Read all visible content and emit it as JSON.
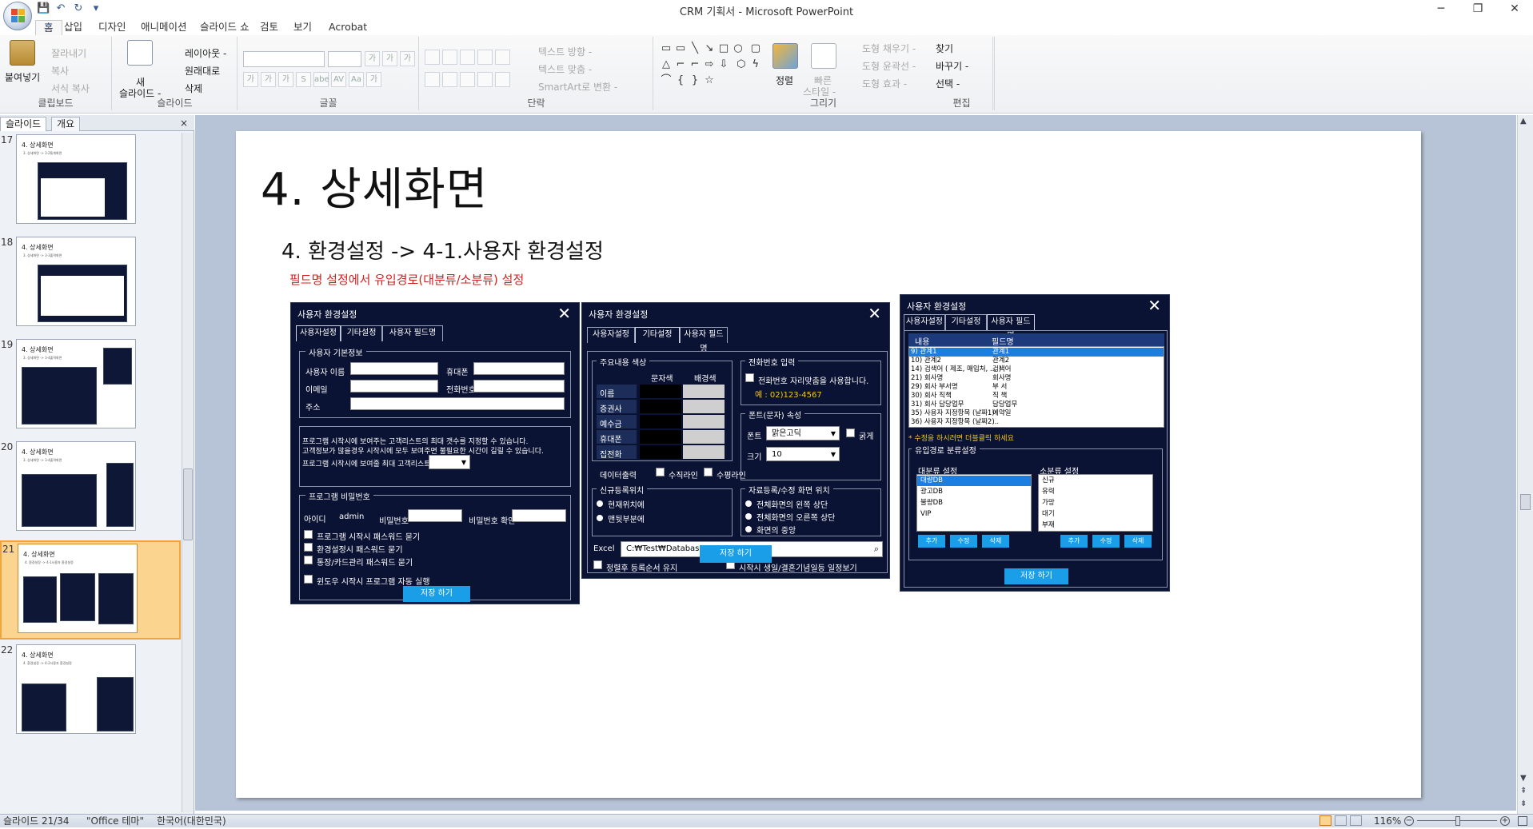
{
  "window": {
    "title": "CRM 기획서 - Microsoft PowerPoint",
    "min": "─",
    "max": "❐",
    "close": "✕"
  },
  "qat": {
    "save": "💾",
    "undo": "↶",
    "redo": "↻",
    "more": "▾"
  },
  "ribbon_tabs": [
    "홈",
    "삽입",
    "디자인",
    "애니메이션",
    "슬라이드 쇼",
    "검토",
    "보기",
    "Acrobat"
  ],
  "ribbon": {
    "clipboard": {
      "paste": "붙여넣기",
      "cut": "잘라내기",
      "copy": "복사",
      "format": "서식 복사",
      "label": "클립보드"
    },
    "slides": {
      "new": "새",
      "new2": "슬라이드 -",
      "layout": "레이아웃 -",
      "reset": "원래대로",
      "delete": "삭제",
      "label": "슬라이드"
    },
    "font": {
      "label": "글꼴",
      "grow": "가",
      "shrink": "가",
      "clear": "가",
      "bold": "가",
      "italic": "가",
      "underline": "가",
      "shadow": "S",
      "strike": "abe",
      "spacing": "AV",
      "case": "Aa",
      "color": "가"
    },
    "paragraph": {
      "direction": "텍스트 방향 -",
      "align": "텍스트 맞춤 -",
      "smartart": "SmartArt로 변환 -",
      "label": "단락"
    },
    "drawing": {
      "arrange": "정렬",
      "quick": "빠른",
      "quick2": "스타일 -",
      "fill": "도형 채우기 -",
      "outline": "도형 윤곽선 -",
      "effect": "도형 효과 -",
      "label": "그리기"
    },
    "editing": {
      "find": "찾기",
      "replace": "바꾸기 -",
      "select": "선택 -",
      "label": "편집"
    }
  },
  "left_panel": {
    "tab_slides": "슬라이드",
    "tab_outline": "개요",
    "close": "×",
    "thumbs": [
      {
        "num": "17",
        "title": "4. 상세화면",
        "sub": "3. 상세화면 -> 3-2통계화면"
      },
      {
        "num": "18",
        "title": "4. 상세화면",
        "sub": "3. 상세화면 -> 3-3출력화면"
      },
      {
        "num": "19",
        "title": "4. 상세화면",
        "sub": "3. 상세화면 -> 3-4출력화면"
      },
      {
        "num": "20",
        "title": "4. 상세화면",
        "sub": "3. 상세화면 -> 3-4출력화면"
      },
      {
        "num": "21",
        "title": "4. 상세화면",
        "sub": "4. 환경설정 -> 4-1사용자 환경설정"
      },
      {
        "num": "22",
        "title": "4. 상세화면",
        "sub": "4. 환경설정 -> 4-2사용자 환경설정"
      }
    ]
  },
  "slide": {
    "title": "4. 상세화면",
    "subtitle": "4. 환경설정 -> 4-1.사용자 환경설정",
    "note": "필드명 설정에서 유입경로(대분류/소분류) 설정",
    "dialog1": {
      "title": "사용자 환경설정",
      "close": "✕",
      "tabs": [
        "사용자설정",
        "기타설정",
        "사용자 필드명"
      ],
      "basic_legend": "사용자 기본정보",
      "name": "사용자 이름",
      "phone": "휴대폰",
      "email": "이메일",
      "tel": "전화번호",
      "addr": "주소",
      "info1": "프로그램 시작시에 보여주는 고객리스트의 최대 갯수를 지정할 수 있습니다.",
      "info2": "고객정보가 많을경우 시작시에 모두 보여주면 불필요한 시간이 길릴 수 있습니다.",
      "maxlist": "프로그램 시작시에 보여줄 최대 고객리스트 수",
      "pw_legend": "프로그램 비밀번호",
      "id_label": "아이디",
      "id_value": "admin",
      "pw": "비밀번호",
      "pw_confirm": "비밀번호 확인",
      "chk1": "프로그램 시작시 패스워드 묻기",
      "chk2": "환경설정시 패스워드 묻기",
      "chk3": "통장/카드관리 패스워드 묻기",
      "chk4": "윈도우 시작시 프로그램 자동 실행",
      "save": "저장 하기"
    },
    "dialog2": {
      "title": "사용자 환경설정",
      "close": "✕",
      "tabs": [
        "사용자설정",
        "기타설정",
        "사용자 필드명"
      ],
      "color_legend": "주요내용 색상",
      "fg": "문자색",
      "bg": "배경색",
      "rows": [
        "이름",
        "증권사",
        "예수금",
        "휴대폰",
        "집전화"
      ],
      "dataout": "데이터출력",
      "vline": "수직라인",
      "hline": "수평라인",
      "phone_legend": "전화번호 입력",
      "phone_chk": "전화번호 자리맞춤을 사용합니다.",
      "phone_ex": "예 : 02)123-4567",
      "font_legend": "폰트(문자) 속성",
      "font_label": "폰트",
      "font_value": "맑은고딕",
      "bold": "굵게",
      "size_label": "크기",
      "size_value": "10",
      "newpos_legend": "신규등록위치",
      "newpos1": "현재위치에",
      "newpos2": "맨뒷부분에",
      "winpos_legend": "자료등록/수정 화면 위치",
      "winpos1": "전체화면의 왼쪽 상단",
      "winpos2": "전체화면의 오른쪽 상단",
      "winpos3": "화면의 중앙",
      "excel": "Excel",
      "excel_path": "C:₩Test₩Database",
      "keep": "정렬후 등록순서 유지",
      "birthday": "시작시 생일/결혼기념일등 일정보기",
      "save": "저장 하기"
    },
    "dialog3": {
      "title": "사용자 환경설정",
      "close": "✕",
      "tabs": [
        "사용자설정",
        "기타설정",
        "사용자 필드명"
      ],
      "col1": "내용",
      "col2": "필드명",
      "rows": [
        {
          "a": "9)  관계1",
          "b": "관계1"
        },
        {
          "a": "10)  관계2",
          "b": "관계2"
        },
        {
          "a": "14)  검색어 ( 제조, 매입처, ... )",
          "b": "검색어"
        },
        {
          "a": "21)  회사명",
          "b": "회사명"
        },
        {
          "a": "29)  회사 부서명",
          "b": "부 서"
        },
        {
          "a": "30)  회사 직책",
          "b": "직 책"
        },
        {
          "a": "31)  회사 담당업무",
          "b": "담당업무"
        },
        {
          "a": "35)  사용자 지정항목 (날짜1)",
          "b": "예약일"
        },
        {
          "a": "36)  사용자 지정항목 (날짜2)",
          "b": "..."
        }
      ],
      "hint": "* 수정을 하시려면 더블클릭 하세요",
      "route_legend": "유입경로 분류설정",
      "big": "대분류 설정",
      "small": "소분류 설정",
      "big_items": [
        "대량DB",
        "광고DB",
        "불량DB",
        "VIP"
      ],
      "small_items": [
        "신규",
        "유력",
        "가망",
        "대기",
        "부재"
      ],
      "add": "추가",
      "edit": "수정",
      "del": "삭제",
      "save": "저장 하기"
    }
  },
  "status": {
    "slide": "슬라이드 21/34",
    "theme": "\"Office 테마\"",
    "lang": "한국어(대한민국)",
    "zoom": "116%"
  },
  "colors": {
    "dialog_bg": "#0b1334",
    "button": "#1a9ee8",
    "selection": "#1a7fe0",
    "note_red": "#d21f1f",
    "highlight": "#fbd48f"
  }
}
